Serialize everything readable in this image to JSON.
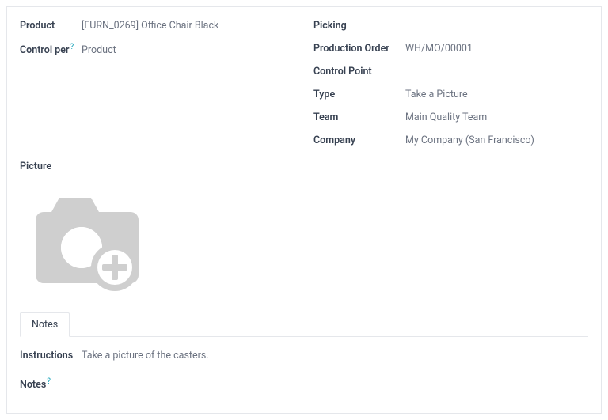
{
  "left": {
    "product": {
      "label": "Product",
      "value": "[FURN_0269] Office Chair Black"
    },
    "control_per": {
      "label": "Control per",
      "value": "Product",
      "help": "?"
    },
    "picture_label": "Picture"
  },
  "right": {
    "picking": {
      "label": "Picking",
      "value": ""
    },
    "production_order": {
      "label": "Production Order",
      "value": "WH/MO/00001"
    },
    "control_point": {
      "label": "Control Point",
      "value": ""
    },
    "type": {
      "label": "Type",
      "value": "Take a Picture"
    },
    "team": {
      "label": "Team",
      "value": "Main Quality Team"
    },
    "company": {
      "label": "Company",
      "value": "My Company (San Francisco)"
    }
  },
  "tabs": {
    "notes": "Notes"
  },
  "instructions": {
    "label": "Instructions",
    "value": "Take a picture of the casters."
  },
  "notes2": {
    "label": "Notes",
    "help": "?"
  }
}
